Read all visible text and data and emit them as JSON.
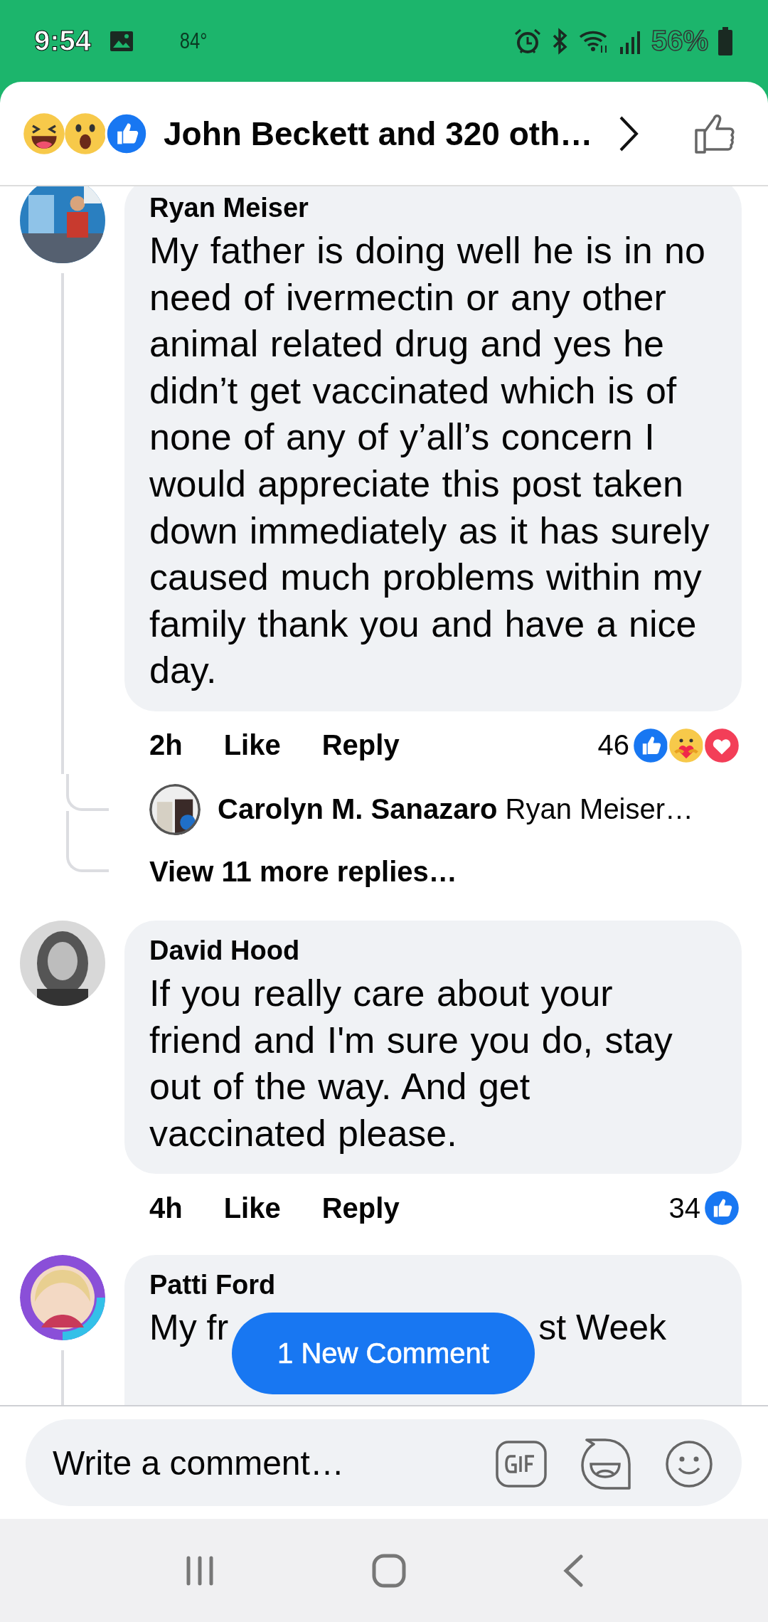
{
  "status_bar": {
    "time": "9:54",
    "temperature": "84°",
    "battery": "56%"
  },
  "header": {
    "reactions": [
      {
        "kind": "haha"
      },
      {
        "kind": "wow"
      },
      {
        "kind": "like"
      }
    ],
    "reactors": "John Beckett and 320 oth…"
  },
  "comments": [
    {
      "author": "Ryan Meiser",
      "thread": true,
      "text": "My father is doing well he is in no need of ivermectin or any other animal related drug and yes he didn’t get vaccinated which is of none of any of y’all’s concern I would appreciate this post taken down immediately as it has surely caused much problems within my family thank you and have a nice day.",
      "time": "2h",
      "like": "Like",
      "reply": "Reply",
      "reaction_count": "46",
      "reactions": [
        {
          "kind": "like"
        },
        {
          "kind": "care"
        },
        {
          "kind": "love"
        }
      ],
      "replies": [
        {
          "author": "Carolyn M. Sanazaro",
          "text": "Ryan Meiser…"
        }
      ],
      "more_replies": "View 11 more replies…"
    },
    {
      "author": "David Hood",
      "thread": false,
      "text": "If you really care about your friend and I'm sure you do, stay out of the way. And get vaccinated please.",
      "time": "4h",
      "like": "Like",
      "reply": "Reply",
      "reaction_count": "34",
      "reactions": [
        {
          "kind": "like"
        }
      ]
    },
    {
      "author": "Patti Ford",
      "thread": true,
      "fragments": [
        "My fr",
        "st Week"
      ]
    }
  ],
  "new_comment_button": "1 New Comment",
  "composer": {
    "placeholder": "Write a comment…"
  }
}
